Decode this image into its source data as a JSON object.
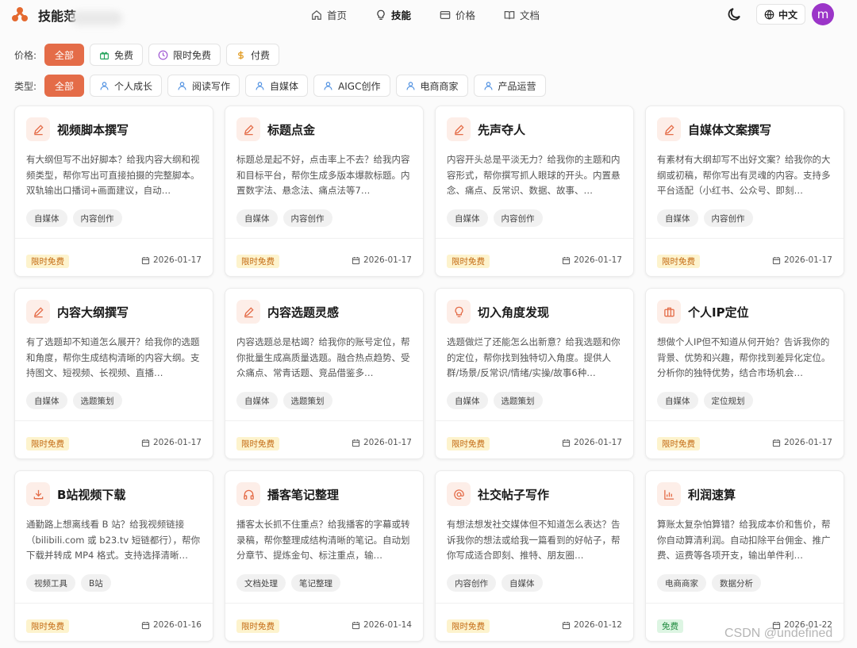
{
  "header": {
    "brand": "技能范",
    "nav": [
      {
        "label": "首页",
        "icon": "home-icon",
        "active": false
      },
      {
        "label": "技能",
        "icon": "lightbulb-icon",
        "active": true
      },
      {
        "label": "价格",
        "icon": "credit-card-icon",
        "active": false
      },
      {
        "label": "文档",
        "icon": "book-icon",
        "active": false
      }
    ],
    "language": "中文",
    "avatar_letter": "m",
    "accent_color": "#e46c48",
    "avatar_color": "#9b35c8"
  },
  "filters": {
    "price_label": "价格:",
    "price_options": [
      {
        "label": "全部",
        "active": true,
        "icon": ""
      },
      {
        "label": "免费",
        "active": false,
        "icon": "gift-icon"
      },
      {
        "label": "限时免费",
        "active": false,
        "icon": "clock-icon"
      },
      {
        "label": "付费",
        "active": false,
        "icon": "dollar-icon"
      }
    ],
    "type_label": "类型:",
    "type_options": [
      {
        "label": "全部",
        "active": true
      },
      {
        "label": "个人成长",
        "active": false
      },
      {
        "label": "阅读写作",
        "active": false
      },
      {
        "label": "自媒体",
        "active": false
      },
      {
        "label": "AIGC创作",
        "active": false
      },
      {
        "label": "电商商家",
        "active": false
      },
      {
        "label": "产品运营",
        "active": false
      }
    ]
  },
  "cards": [
    {
      "title": "视频脚本撰写",
      "icon": "pencil-icon",
      "desc": "有大纲但写不出好脚本？给我内容大纲和视频类型，帮你写出可直接拍摄的完整脚本。双轨输出口播词+画面建议，自动…",
      "tags": [
        "自媒体",
        "内容创作"
      ],
      "badge": "限时免费",
      "badge_type": "limited",
      "date": "2026-01-17"
    },
    {
      "title": "标题点金",
      "icon": "pencil-icon",
      "desc": "标题总是起不好，点击率上不去？给我内容和目标平台，帮你生成多版本爆款标题。内置数字法、悬念法、痛点法等7…",
      "tags": [
        "自媒体",
        "内容创作"
      ],
      "badge": "限时免费",
      "badge_type": "limited",
      "date": "2026-01-17"
    },
    {
      "title": "先声夺人",
      "icon": "pencil-icon",
      "desc": "内容开头总是平淡无力？给我你的主题和内容形式，帮你撰写抓人眼球的开头。内置悬念、痛点、反常识、数据、故事、…",
      "tags": [
        "自媒体",
        "内容创作"
      ],
      "badge": "限时免费",
      "badge_type": "limited",
      "date": "2026-01-17"
    },
    {
      "title": "自媒体文案撰写",
      "icon": "pencil-icon",
      "desc": "有素材有大纲却写不出好文案？给我你的大纲或初稿，帮你写出有灵魂的内容。支持多平台适配（小红书、公众号、即刻…",
      "tags": [
        "自媒体",
        "内容创作"
      ],
      "badge": "限时免费",
      "badge_type": "limited",
      "date": "2026-01-17"
    },
    {
      "title": "内容大纲撰写",
      "icon": "pencil-icon",
      "desc": "有了选题却不知道怎么展开？给我你的选题和角度，帮你生成结构清晰的内容大纲。支持图文、短视频、长视频、直播…",
      "tags": [
        "自媒体",
        "选题策划"
      ],
      "badge": "限时免费",
      "badge_type": "limited",
      "date": "2026-01-17"
    },
    {
      "title": "内容选题灵感",
      "icon": "pencil-icon",
      "desc": "内容选题总是枯竭？给我你的账号定位，帮你批量生成高质量选题。融合热点趋势、受众痛点、常青话题、竞品借鉴多…",
      "tags": [
        "自媒体",
        "选题策划"
      ],
      "badge": "限时免费",
      "badge_type": "limited",
      "date": "2026-01-17"
    },
    {
      "title": "切入角度发现",
      "icon": "lightbulb-icon",
      "desc": "选题做烂了还能怎么出新意？给我选题和你的定位，帮你找到独特切入角度。提供人群/场景/反常识/情绪/实操/故事6种…",
      "tags": [
        "自媒体",
        "选题策划"
      ],
      "badge": "限时免费",
      "badge_type": "limited",
      "date": "2026-01-17"
    },
    {
      "title": "个人IP定位",
      "icon": "briefcase-icon",
      "desc": "想做个人IP但不知道从何开始？告诉我你的背景、优势和兴趣，帮你找到差异化定位。分析你的独特优势，结合市场机会…",
      "tags": [
        "自媒体",
        "定位规划"
      ],
      "badge": "限时免费",
      "badge_type": "limited",
      "date": "2026-01-17"
    },
    {
      "title": "B站视频下载",
      "icon": "download-icon",
      "desc": "通勤路上想离线看 B 站？给我视频链接（bilibili.com 或 b23.tv 短链都行），帮你下载并转成 MP4 格式。支持选择清晰…",
      "tags": [
        "视频工具",
        "B站"
      ],
      "badge": "限时免费",
      "badge_type": "limited",
      "date": "2026-01-16"
    },
    {
      "title": "播客笔记整理",
      "icon": "headphones-icon",
      "desc": "播客太长抓不住重点？给我播客的字幕或转录稿，帮你整理成结构清晰的笔记。自动划分章节、提炼金句、标注重点，输…",
      "tags": [
        "文档处理",
        "笔记整理"
      ],
      "badge": "限时免费",
      "badge_type": "limited",
      "date": "2026-01-14"
    },
    {
      "title": "社交帖子写作",
      "icon": "at-icon",
      "desc": "有想法想发社交媒体但不知道怎么表达？告诉我你的想法或给我一篇看到的好帖子，帮你写成适合即刻、推特、朋友圈…",
      "tags": [
        "内容创作",
        "自媒体"
      ],
      "badge": "限时免费",
      "badge_type": "limited",
      "date": "2026-01-12"
    },
    {
      "title": "利润速算",
      "icon": "bar-chart-icon",
      "desc": "算账太复杂怕算错？给我成本价和售价，帮你自动算清利润。自动扣除平台佣金、推广费、运费等各项开支，输出单件利…",
      "tags": [
        "电商商家",
        "数据分析"
      ],
      "badge": "免费",
      "badge_type": "free",
      "date": "2026-01-22"
    }
  ],
  "watermark": "CSDN @undefined"
}
